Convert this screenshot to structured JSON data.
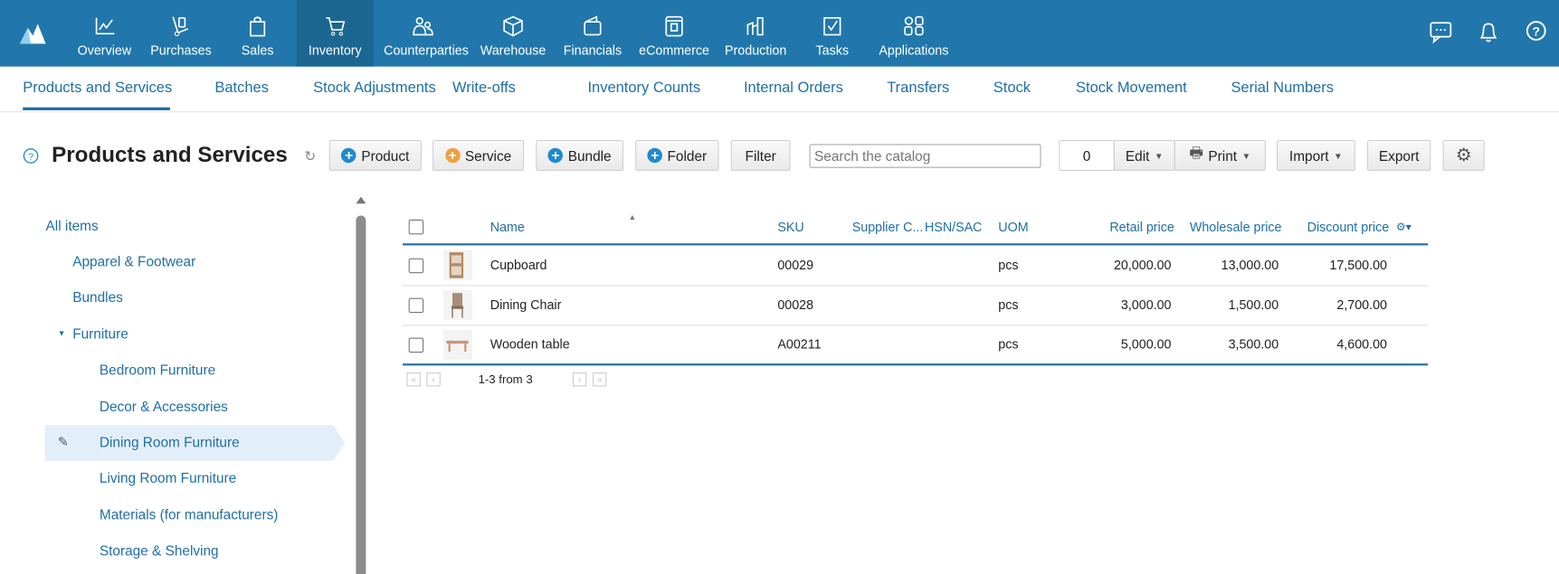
{
  "topnav": {
    "items": [
      {
        "label": "Overview",
        "icon": "chart-line-icon"
      },
      {
        "label": "Purchases",
        "icon": "hand-truck-icon"
      },
      {
        "label": "Sales",
        "icon": "shopping-bag-icon"
      },
      {
        "label": "Inventory",
        "icon": "cart-icon",
        "active": true
      },
      {
        "label": "Counterparties",
        "icon": "people-icon"
      },
      {
        "label": "Warehouse",
        "icon": "box-icon"
      },
      {
        "label": "Financials",
        "icon": "wallet-icon"
      },
      {
        "label": "eCommerce",
        "icon": "storefront-icon"
      },
      {
        "label": "Production",
        "icon": "factory-icon"
      },
      {
        "label": "Tasks",
        "icon": "checkbox-icon"
      },
      {
        "label": "Applications",
        "icon": "apps-icon"
      }
    ],
    "right_icons": [
      "chat-icon",
      "bell-icon",
      "help-icon"
    ]
  },
  "subnav": {
    "items": [
      "Products and Services",
      "Batches",
      "Stock Adjustments",
      "Write-offs",
      "Inventory Counts",
      "Internal Orders",
      "Transfers",
      "Stock",
      "Stock Movement",
      "Serial Numbers"
    ],
    "active": 0
  },
  "toolbar": {
    "title": "Products and Services",
    "product": "Product",
    "service": "Service",
    "bundle": "Bundle",
    "folder": "Folder",
    "filter": "Filter",
    "search_placeholder": "Search the catalog",
    "selected_count": "0",
    "edit": "Edit",
    "print": "Print",
    "import": "Import",
    "export": "Export"
  },
  "tree": {
    "all": "All items",
    "items": [
      {
        "label": "Apparel & Footwear",
        "level": 1
      },
      {
        "label": "Bundles",
        "level": 1
      },
      {
        "label": "Furniture",
        "level": 1,
        "expanded": true
      },
      {
        "label": "Bedroom Furniture",
        "level": 2
      },
      {
        "label": "Decor & Accessories",
        "level": 2
      },
      {
        "label": "Dining Room Furniture",
        "level": 2,
        "selected": true
      },
      {
        "label": "Living Room Furniture",
        "level": 2
      },
      {
        "label": "Materials (for manufacturers)",
        "level": 2
      },
      {
        "label": "Storage & Shelving",
        "level": 2
      }
    ]
  },
  "table": {
    "headers": {
      "name": "Name",
      "sku": "SKU",
      "supplier": "Supplier C...",
      "hsn": "HSN/SAC",
      "uom": "UOM",
      "retail": "Retail price",
      "wholesale": "Wholesale price",
      "discount": "Discount price"
    },
    "rows": [
      {
        "name": "Cupboard",
        "sku": "00029",
        "uom": "pcs",
        "retail": "20,000.00",
        "wholesale": "13,000.00",
        "discount": "17,500.00"
      },
      {
        "name": "Dining Chair",
        "sku": "00028",
        "uom": "pcs",
        "retail": "3,000.00",
        "wholesale": "1,500.00",
        "discount": "2,700.00"
      },
      {
        "name": "Wooden table",
        "sku": "A00211",
        "uom": "pcs",
        "retail": "5,000.00",
        "wholesale": "3,500.00",
        "discount": "4,600.00"
      }
    ],
    "pagination": "1-3 from 3"
  },
  "colors": {
    "brand": "#2177ab",
    "accent": "#1f6fa6",
    "service": "#f0a040",
    "selected": "#e3eff8"
  }
}
